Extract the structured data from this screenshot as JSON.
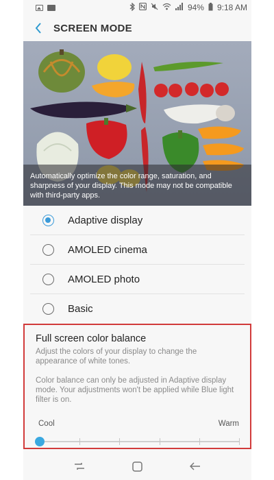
{
  "status_bar": {
    "battery": "94%",
    "time": "9:18 AM"
  },
  "header": {
    "title": "SCREEN MODE"
  },
  "banner": {
    "caption": "Automatically optimize the color range, saturation, and sharpness of your display. This mode may not be compatible with third-party apps."
  },
  "options": [
    {
      "label": "Adaptive display",
      "selected": true
    },
    {
      "label": "AMOLED cinema",
      "selected": false
    },
    {
      "label": "AMOLED photo",
      "selected": false
    },
    {
      "label": "Basic",
      "selected": false
    }
  ],
  "balance": {
    "title": "Full screen color balance",
    "description": "Adjust the colors of your display to change the appearance of white tones.",
    "note": "Color balance can only be adjusted in Adaptive display mode. Your adjustments won't be applied while Blue light filter is on.",
    "left_label": "Cool",
    "right_label": "Warm",
    "level": 0,
    "steps": 5
  },
  "colors": {
    "accent": "#3a9ad9",
    "highlight_border": "#d13a3a"
  }
}
